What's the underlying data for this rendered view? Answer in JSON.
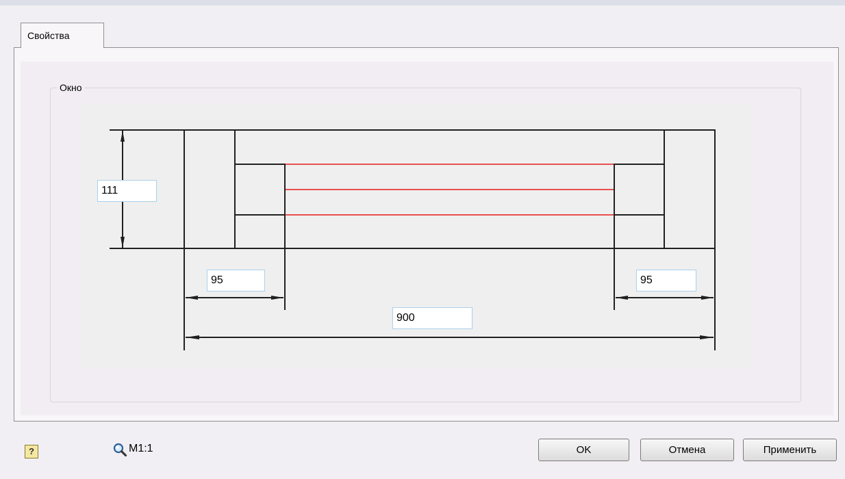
{
  "tabs": [
    {
      "label": "Свойства"
    }
  ],
  "group": {
    "label": "Окно"
  },
  "dimensions": {
    "height": "111",
    "left_width": "95",
    "right_width": "95",
    "total_width": "900"
  },
  "colors": {
    "accent_line": "#e85050",
    "drawing_line": "#202020",
    "input_border": "#aad0ec"
  },
  "footer": {
    "help_icon": "?",
    "zoom_icon": "magnifier-icon",
    "scale_label": "M1:1"
  },
  "buttons": {
    "ok": "OK",
    "cancel": "Отмена",
    "apply": "Применить"
  }
}
